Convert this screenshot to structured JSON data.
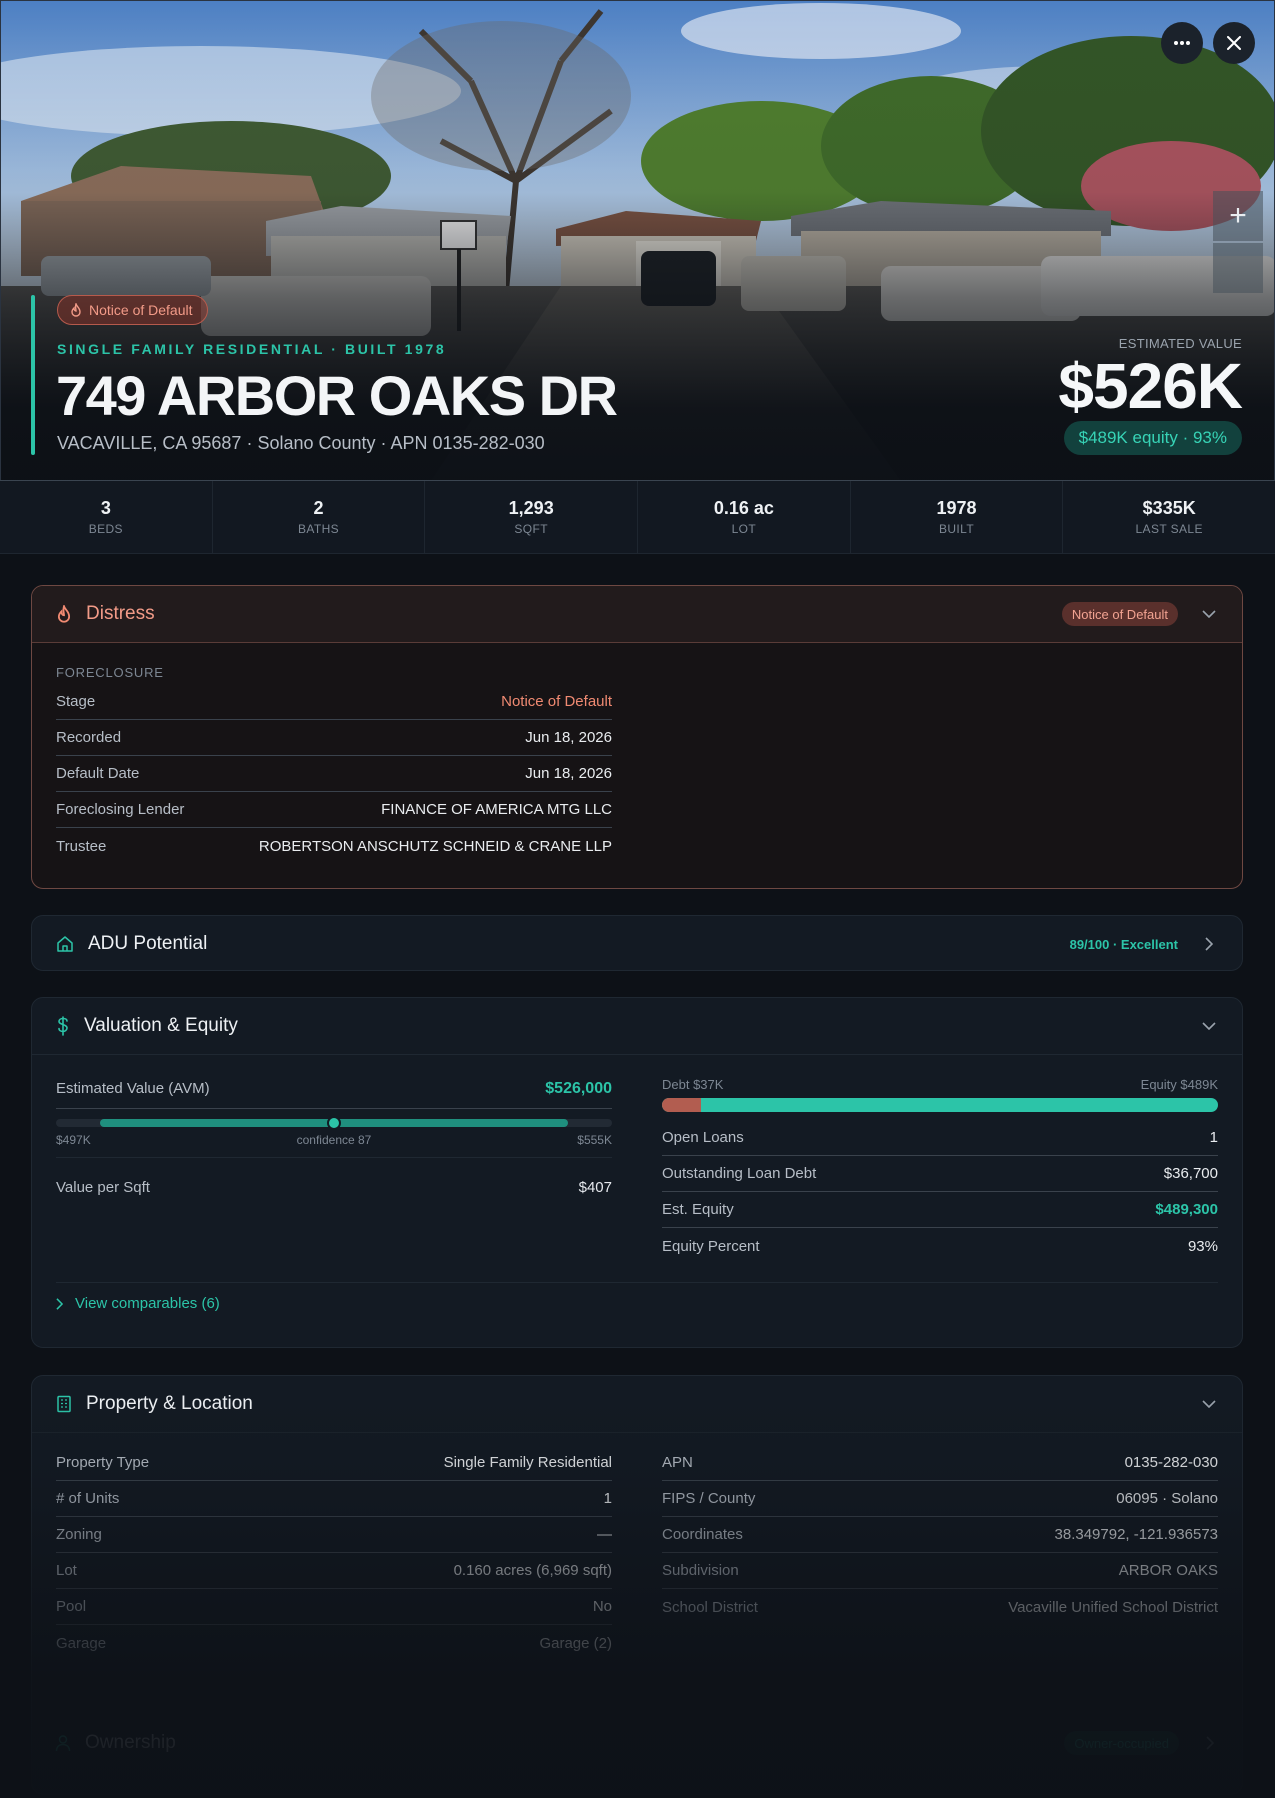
{
  "hero": {
    "distress_tag": "Notice of Default",
    "kicker": "SINGLE FAMILY RESIDENTIAL · BUILT 1978",
    "address": "749 ARBOR OAKS DR",
    "subline": "VACAVILLE, CA 95687 · Solano County · APN 0135-282-030",
    "estimated_value_label": "ESTIMATED VALUE",
    "estimated_value": "$526K",
    "equity_pill": "$489K equity · 93%",
    "zoom_in_label": "+"
  },
  "stats": [
    {
      "value": "3",
      "label": "BEDS"
    },
    {
      "value": "2",
      "label": "BATHS"
    },
    {
      "value": "1,293",
      "label": "SQFT"
    },
    {
      "value": "0.16 ac",
      "label": "LOT"
    },
    {
      "value": "1978",
      "label": "BUILT"
    },
    {
      "value": "$335K",
      "label": "LAST SALE"
    }
  ],
  "distress": {
    "title": "Distress",
    "tag": "Notice of Default",
    "section": "FORECLOSURE",
    "rows": [
      {
        "k": "Stage",
        "v": "Notice of Default"
      },
      {
        "k": "Recorded",
        "v": "Jun 18, 2026"
      },
      {
        "k": "Default Date",
        "v": "Jun 18, 2026"
      },
      {
        "k": "Foreclosing Lender",
        "v": "FINANCE OF AMERICA MTG LLC"
      },
      {
        "k": "Trustee",
        "v": "ROBERTSON ANSCHUTZ SCHNEID & CRANE LLP"
      }
    ]
  },
  "adu": {
    "title": "ADU Potential",
    "score": "89/100 · Excellent"
  },
  "valuation": {
    "title": "Valuation & Equity",
    "avm_label": "Estimated Value (AVM)",
    "avm_value": "$526,000",
    "range_low": "$497K",
    "range_mid": "confidence 87",
    "range_high": "$555K",
    "range_fill_start": 0.08,
    "range_fill_end": 0.92,
    "range_point": 0.5,
    "value_per_sqft_label": "Value per Sqft",
    "value_per_sqft": "$407",
    "debt_label": "Debt $37K",
    "equity_label": "Equity $489K",
    "debt_fraction": 0.07,
    "rows": [
      {
        "k": "Open Loans",
        "v": "1"
      },
      {
        "k": "Outstanding Loan Debt",
        "v": "$36,700"
      },
      {
        "k": "Est. Equity",
        "v": "$489,300"
      },
      {
        "k": "Equity Percent",
        "v": "93%"
      }
    ],
    "comparables_link": "View comparables (6)"
  },
  "property": {
    "title": "Property & Location",
    "left": [
      {
        "k": "Property Type",
        "v": "Single Family Residential"
      },
      {
        "k": "# of Units",
        "v": "1"
      },
      {
        "k": "Zoning",
        "v": "—"
      },
      {
        "k": "Lot",
        "v": "0.160 acres (6,969 sqft)"
      },
      {
        "k": "Pool",
        "v": "No"
      },
      {
        "k": "Garage",
        "v": "Garage (2)"
      }
    ],
    "right": [
      {
        "k": "APN",
        "v": "0135-282-030"
      },
      {
        "k": "FIPS / County",
        "v": "06095 · Solano"
      },
      {
        "k": "Coordinates",
        "v": "38.349792, -121.936573"
      },
      {
        "k": "Subdivision",
        "v": "ARBOR OAKS"
      },
      {
        "k": "School District",
        "v": "Vacaville Unified School District"
      }
    ]
  },
  "ownership": {
    "title": "Ownership",
    "tag": "Owner-occupied"
  },
  "colors": {
    "accent": "#2cc4a8",
    "distress": "#f29b88",
    "background": "#0d1117"
  }
}
